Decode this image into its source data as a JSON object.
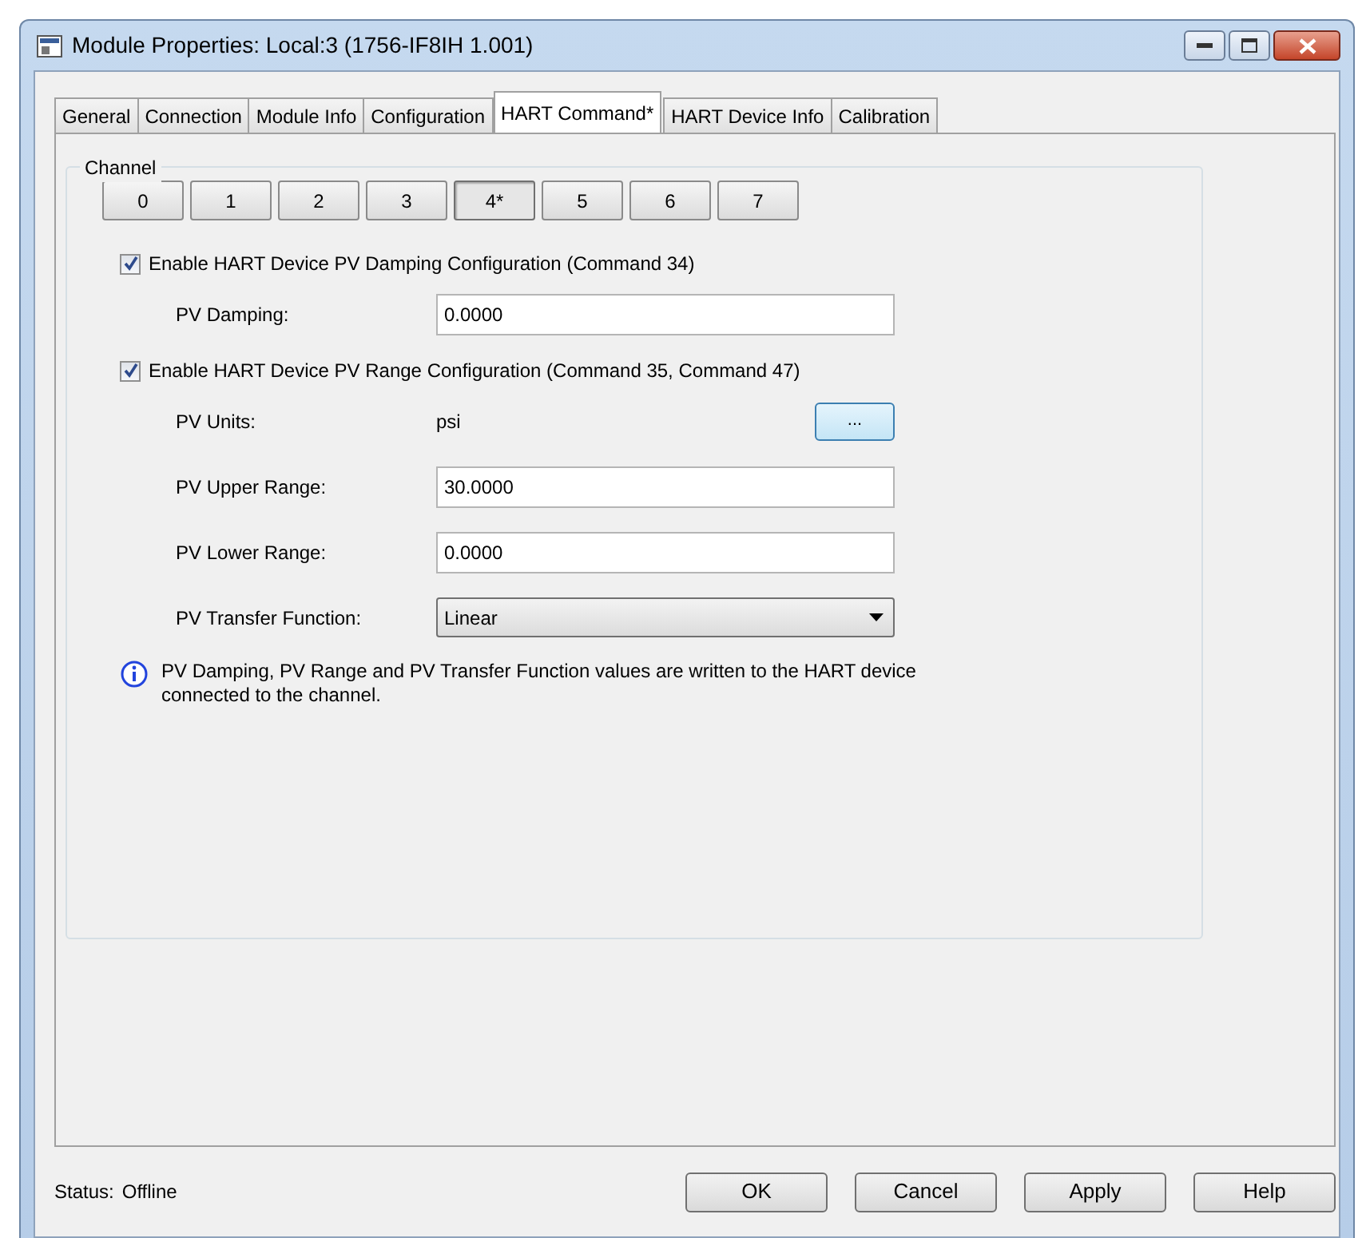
{
  "window": {
    "title": "Module Properties: Local:3 (1756-IF8IH 1.001)"
  },
  "tabs": [
    {
      "label": "General",
      "selected": false
    },
    {
      "label": "Connection",
      "selected": false
    },
    {
      "label": "Module Info",
      "selected": false
    },
    {
      "label": "Configuration",
      "selected": false
    },
    {
      "label": "HART Command*",
      "selected": true
    },
    {
      "label": "HART Device Info",
      "selected": false
    },
    {
      "label": "Calibration",
      "selected": false
    }
  ],
  "channel_group": {
    "title": "Channel",
    "channels": [
      {
        "label": "0",
        "selected": false
      },
      {
        "label": "1",
        "selected": false
      },
      {
        "label": "2",
        "selected": false
      },
      {
        "label": "3",
        "selected": false
      },
      {
        "label": "4*",
        "selected": true
      },
      {
        "label": "5",
        "selected": false
      },
      {
        "label": "6",
        "selected": false
      },
      {
        "label": "7",
        "selected": false
      }
    ],
    "sections": [
      {
        "label": "Enable HART Device PV Damping Configuration (Command 34)",
        "checked": true,
        "fields": [
          {
            "kind": "input",
            "label": "PV Damping:",
            "value": "0.0000"
          }
        ]
      },
      {
        "label": "Enable HART Device PV Range Configuration (Command 35, Command 47)",
        "checked": true,
        "fields": [
          {
            "kind": "text",
            "label": "PV Units:",
            "value": "psi",
            "button": "..."
          },
          {
            "kind": "input",
            "label": "PV Upper Range:",
            "value": "30.0000"
          },
          {
            "kind": "input",
            "label": "PV Lower Range:",
            "value": "0.0000"
          },
          {
            "kind": "select",
            "label": "PV Transfer Function:",
            "value": "Linear"
          }
        ]
      }
    ],
    "info": "PV Damping, PV Range and PV Transfer Function values are written to the HART device connected to the channel."
  },
  "status_bar": {
    "label": "Status:",
    "value": "Offline"
  },
  "buttons": [
    "OK",
    "Cancel",
    "Apply",
    "Help"
  ]
}
